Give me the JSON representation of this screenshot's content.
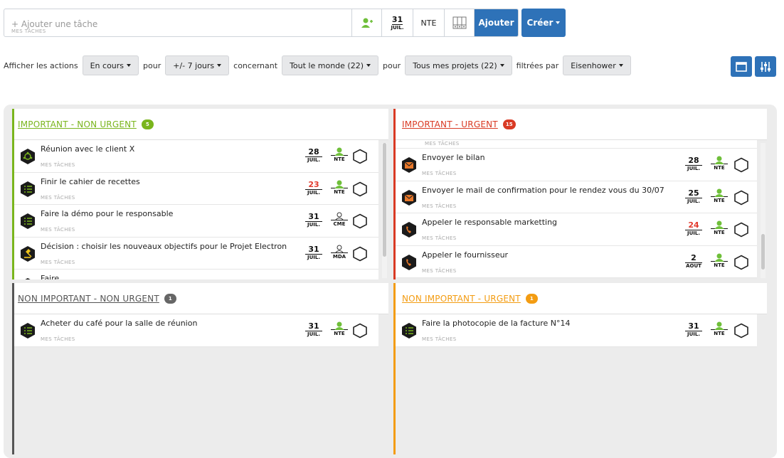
{
  "topbar": {
    "task_placeholder": "+ Ajouter une tâche",
    "task_project": "MES TÂCHES",
    "date_day": "31",
    "date_month": "JUIL.",
    "assignee": "NTE",
    "add_label": "Ajouter",
    "create_label": "Créer"
  },
  "filters": {
    "label_show": "Afficher les actions",
    "status": "En cours",
    "label_for1": "pour",
    "period": "+/- 7 jours",
    "label_concerning": "concernant",
    "people": "Tout le monde (22)",
    "label_for2": "pour",
    "projects": "Tous mes projets (22)",
    "label_filtered": "filtrées par",
    "matrix": "Eisenhower"
  },
  "colors": {
    "important_not_urgent": "#7ab51d",
    "important_urgent": "#d93a24",
    "not_important_not_urgent": "#555555",
    "not_important_urgent": "#f39c12",
    "primary": "#2e72b8"
  },
  "quadrants": {
    "q1": {
      "title": "IMPORTANT - NON URGENT",
      "count": "5",
      "tasks": [
        {
          "icon": "meeting-icon",
          "title": "Réunion avec le client X",
          "project": "MES TÂCHES",
          "day": "28",
          "month": "JUIL.",
          "user": "NTE"
        },
        {
          "icon": "list-icon",
          "title": "Finir le cahier de recettes",
          "project": "MES TÂCHES",
          "day": "23",
          "month": "JUIL.",
          "user": "NTE",
          "late": true
        },
        {
          "icon": "list-icon",
          "title": "Faire la démo pour le responsable",
          "project": "MES TÂCHES",
          "day": "31",
          "month": "JUIL.",
          "user": "CME"
        },
        {
          "icon": "gavel-icon",
          "title": "Décision : choisir les nouveaux objectifs pour le Projet Electron",
          "project": "MES TÂCHES",
          "day": "31",
          "month": "JUIL.",
          "user": "MDA"
        },
        {
          "icon": "list-icon",
          "title": "Faire",
          "project": "",
          "day": "",
          "month": "",
          "user": ""
        }
      ]
    },
    "q2": {
      "title": "IMPORTANT - URGENT",
      "count": "15",
      "top_project": "MES TÂCHES",
      "tasks": [
        {
          "icon": "mail-icon",
          "title": "Envoyer le bilan",
          "project": "MES TÂCHES",
          "day": "28",
          "month": "JUIL.",
          "user": "NTE"
        },
        {
          "icon": "mail-icon",
          "title": "Envoyer le mail de confirmation pour le rendez vous du 30/07",
          "project": "MES TÂCHES",
          "day": "25",
          "month": "JUIL.",
          "user": "NTE"
        },
        {
          "icon": "phone-icon",
          "title": "Appeler le responsable marketting",
          "project": "MES TÂCHES",
          "day": "24",
          "month": "JUIL.",
          "user": "NTE",
          "late": true
        },
        {
          "icon": "phone-icon",
          "title": "Appeler le fournisseur",
          "project": "MES TÂCHES",
          "day": "2",
          "month": "AOUT",
          "user": "NTE"
        }
      ]
    },
    "q3": {
      "title": "NON IMPORTANT - NON URGENT",
      "count": "1",
      "tasks": [
        {
          "icon": "list-icon",
          "title": "Acheter du café pour la salle de réunion",
          "project": "MES TÂCHES",
          "day": "31",
          "month": "JUIL.",
          "user": "NTE"
        }
      ]
    },
    "q4": {
      "title": "NON IMPORTANT - URGENT",
      "count": "1",
      "tasks": [
        {
          "icon": "list-icon",
          "title": "Faire la photocopie de la facture N°14",
          "project": "MES TÂCHES",
          "day": "31",
          "month": "JUIL.",
          "user": "NTE"
        }
      ]
    }
  }
}
